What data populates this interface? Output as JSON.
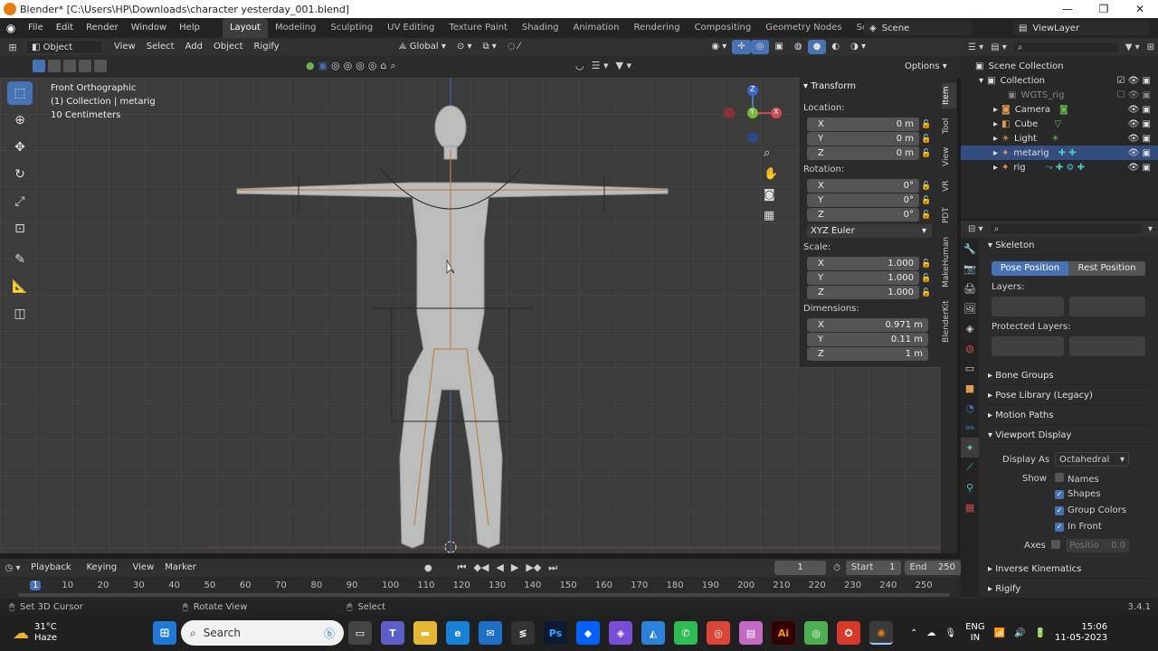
{
  "window": {
    "title": "Blender* [C:\\Users\\HP\\Downloads\\character yesterday_001.blend]",
    "minimize": "—",
    "maximize": "❐",
    "close": "✕"
  },
  "menubar": {
    "items": [
      "File",
      "Edit",
      "Render",
      "Window",
      "Help"
    ],
    "workspaces": [
      "Layout",
      "Modeling",
      "Sculpting",
      "UV Editing",
      "Texture Paint",
      "Shading",
      "Animation",
      "Rendering",
      "Compositing",
      "Geometry Nodes",
      "Scripting"
    ],
    "active_workspace": "Layout",
    "add_tab": "+",
    "scene": "Scene",
    "view_layer": "ViewLayer"
  },
  "viewport_header": {
    "mode": "Object Mode",
    "menus": [
      "View",
      "Select",
      "Add",
      "Object",
      "Rigify"
    ],
    "transform_orientation": "Global",
    "options": "Options"
  },
  "viewport": {
    "view_name": "Front Orthographic",
    "collection_info": "(1) Collection | metarig",
    "scale_info": "10 Centimeters",
    "gizmo": {
      "x": "X",
      "y": "Y",
      "z": "Z"
    }
  },
  "npanel": {
    "header": "Transform",
    "location_label": "Location:",
    "location": [
      {
        "axis": "X",
        "value": "0 m"
      },
      {
        "axis": "Y",
        "value": "0 m"
      },
      {
        "axis": "Z",
        "value": "0 m"
      }
    ],
    "rotation_label": "Rotation:",
    "rotation": [
      {
        "axis": "X",
        "value": "0°"
      },
      {
        "axis": "Y",
        "value": "0°"
      },
      {
        "axis": "Z",
        "value": "0°"
      }
    ],
    "rotation_mode": "XYZ Euler",
    "scale_label": "Scale:",
    "scale": [
      {
        "axis": "X",
        "value": "1.000"
      },
      {
        "axis": "Y",
        "value": "1.000"
      },
      {
        "axis": "Z",
        "value": "1.000"
      }
    ],
    "dimensions_label": "Dimensions:",
    "dimensions": [
      {
        "axis": "X",
        "value": "0.971 m"
      },
      {
        "axis": "Y",
        "value": "0.11 m"
      },
      {
        "axis": "Z",
        "value": "1 m"
      }
    ],
    "tabs": [
      "Item",
      "Tool",
      "View",
      "VR",
      "PDT",
      "MakeHuman",
      "BlenderKit"
    ]
  },
  "outliner": {
    "root": "Scene Collection",
    "collection": "Collection",
    "items": [
      "WGTS_rig",
      "Camera",
      "Cube",
      "Light",
      "metarig",
      "rig"
    ]
  },
  "properties": {
    "skeleton_header": "Skeleton",
    "pose_position": "Pose Position",
    "rest_position": "Rest Position",
    "layers_label": "Layers:",
    "protected_layers_label": "Protected Layers:",
    "sections": [
      "Bone Groups",
      "Pose Library (Legacy)",
      "Motion Paths"
    ],
    "viewport_display_header": "Viewport Display",
    "display_as_label": "Display As",
    "display_as_value": "Octahedral",
    "show_label": "Show",
    "show_options": [
      {
        "label": "Names",
        "checked": false
      },
      {
        "label": "Shapes",
        "checked": true
      },
      {
        "label": "Group Colors",
        "checked": true
      },
      {
        "label": "In Front",
        "checked": true
      }
    ],
    "axes_label": "Axes",
    "axes_position_label": "Positio",
    "axes_position_value": "0.0",
    "bottom_sections": [
      "Inverse Kinematics",
      "Rigify"
    ]
  },
  "timeline": {
    "menus": [
      "Playback",
      "Keying",
      "View",
      "Marker"
    ],
    "current_frame": "1",
    "start_label": "Start",
    "start_value": "1",
    "end_label": "End",
    "end_value": "250",
    "ruler": [
      "1",
      "10",
      "20",
      "30",
      "40",
      "50",
      "60",
      "70",
      "80",
      "90",
      "100",
      "110",
      "120",
      "130",
      "140",
      "150",
      "160",
      "170",
      "180",
      "190",
      "200",
      "210",
      "220",
      "230",
      "240",
      "250"
    ]
  },
  "statusbar": {
    "hints": [
      "Set 3D Cursor",
      "Rotate View",
      "Select"
    ],
    "version": "3.4.1"
  },
  "taskbar": {
    "weather_temp": "31°C",
    "weather_desc": "Haze",
    "search_placeholder": "Search",
    "lang_top": "ENG",
    "lang_bottom": "IN",
    "time": "15:06",
    "date": "11-05-2023"
  }
}
